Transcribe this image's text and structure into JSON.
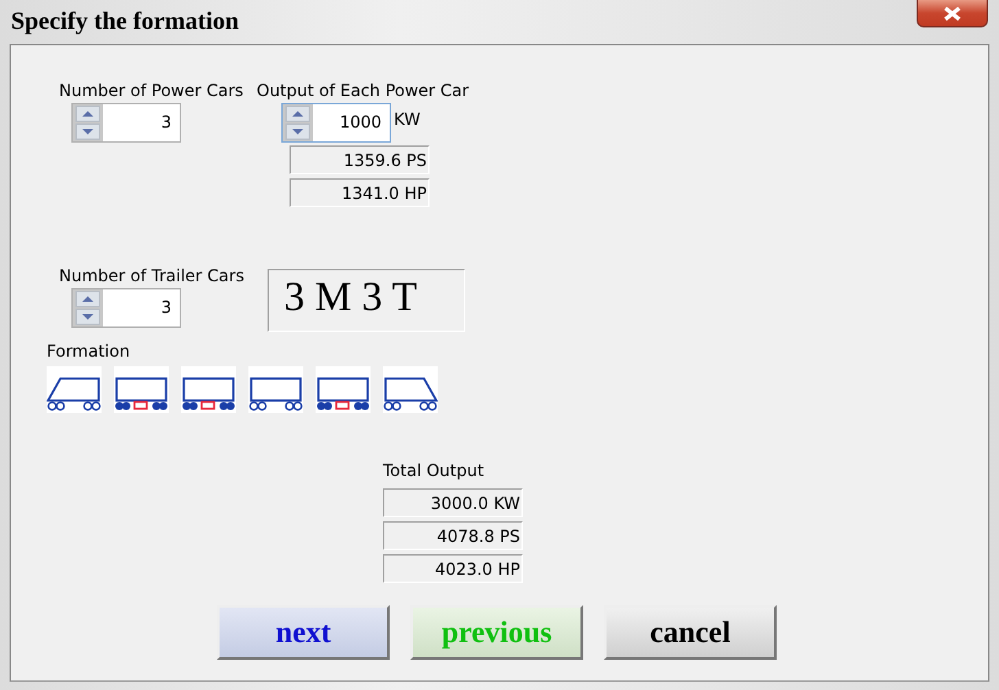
{
  "window": {
    "title": "Specify the formation"
  },
  "power_cars": {
    "label": "Number of Power Cars",
    "value": "3"
  },
  "output_each": {
    "label": "Output of Each Power Car",
    "value": "1000",
    "unit": "KW",
    "readouts": [
      "1359.6 PS",
      "1341.0 HP"
    ]
  },
  "trailer_cars": {
    "label": "Number of Trailer Cars",
    "value": "3"
  },
  "formation_code": "3 M 3 T",
  "formation": {
    "label": "Formation",
    "cars": [
      {
        "kind": "cab-left"
      },
      {
        "kind": "motor"
      },
      {
        "kind": "motor"
      },
      {
        "kind": "trailer"
      },
      {
        "kind": "motor"
      },
      {
        "kind": "cab-right"
      }
    ]
  },
  "total_output": {
    "label": "Total Output",
    "readouts": [
      "3000.0 KW",
      "4078.8 PS",
      "4023.0 HP"
    ]
  },
  "buttons": [
    {
      "label": "next",
      "kind": "next"
    },
    {
      "label": "previous",
      "kind": "previous"
    },
    {
      "label": "cancel",
      "kind": "cancel"
    }
  ]
}
